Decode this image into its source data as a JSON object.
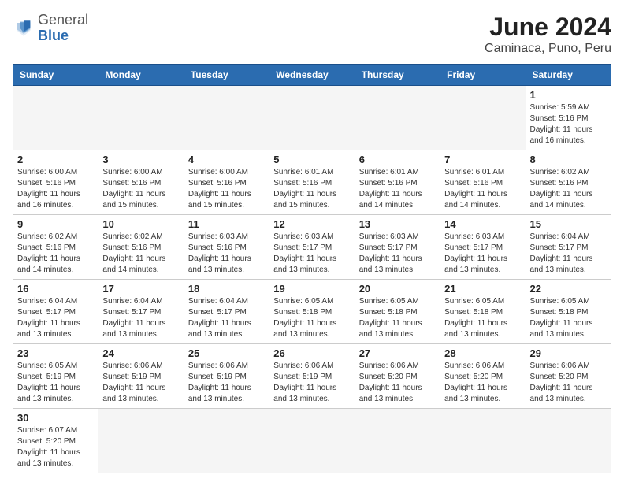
{
  "header": {
    "logo_general": "General",
    "logo_blue": "Blue",
    "month_year": "June 2024",
    "location": "Caminaca, Puno, Peru"
  },
  "days_of_week": [
    "Sunday",
    "Monday",
    "Tuesday",
    "Wednesday",
    "Thursday",
    "Friday",
    "Saturday"
  ],
  "weeks": [
    [
      {
        "day": null,
        "info": null
      },
      {
        "day": null,
        "info": null
      },
      {
        "day": null,
        "info": null
      },
      {
        "day": null,
        "info": null
      },
      {
        "day": null,
        "info": null
      },
      {
        "day": null,
        "info": null
      },
      {
        "day": "1",
        "info": "Sunrise: 5:59 AM\nSunset: 5:16 PM\nDaylight: 11 hours and 16 minutes."
      }
    ],
    [
      {
        "day": "2",
        "info": "Sunrise: 6:00 AM\nSunset: 5:16 PM\nDaylight: 11 hours and 16 minutes."
      },
      {
        "day": "3",
        "info": "Sunrise: 6:00 AM\nSunset: 5:16 PM\nDaylight: 11 hours and 15 minutes."
      },
      {
        "day": "4",
        "info": "Sunrise: 6:00 AM\nSunset: 5:16 PM\nDaylight: 11 hours and 15 minutes."
      },
      {
        "day": "5",
        "info": "Sunrise: 6:01 AM\nSunset: 5:16 PM\nDaylight: 11 hours and 15 minutes."
      },
      {
        "day": "6",
        "info": "Sunrise: 6:01 AM\nSunset: 5:16 PM\nDaylight: 11 hours and 14 minutes."
      },
      {
        "day": "7",
        "info": "Sunrise: 6:01 AM\nSunset: 5:16 PM\nDaylight: 11 hours and 14 minutes."
      },
      {
        "day": "8",
        "info": "Sunrise: 6:02 AM\nSunset: 5:16 PM\nDaylight: 11 hours and 14 minutes."
      }
    ],
    [
      {
        "day": "9",
        "info": "Sunrise: 6:02 AM\nSunset: 5:16 PM\nDaylight: 11 hours and 14 minutes."
      },
      {
        "day": "10",
        "info": "Sunrise: 6:02 AM\nSunset: 5:16 PM\nDaylight: 11 hours and 14 minutes."
      },
      {
        "day": "11",
        "info": "Sunrise: 6:03 AM\nSunset: 5:16 PM\nDaylight: 11 hours and 13 minutes."
      },
      {
        "day": "12",
        "info": "Sunrise: 6:03 AM\nSunset: 5:17 PM\nDaylight: 11 hours and 13 minutes."
      },
      {
        "day": "13",
        "info": "Sunrise: 6:03 AM\nSunset: 5:17 PM\nDaylight: 11 hours and 13 minutes."
      },
      {
        "day": "14",
        "info": "Sunrise: 6:03 AM\nSunset: 5:17 PM\nDaylight: 11 hours and 13 minutes."
      },
      {
        "day": "15",
        "info": "Sunrise: 6:04 AM\nSunset: 5:17 PM\nDaylight: 11 hours and 13 minutes."
      }
    ],
    [
      {
        "day": "16",
        "info": "Sunrise: 6:04 AM\nSunset: 5:17 PM\nDaylight: 11 hours and 13 minutes."
      },
      {
        "day": "17",
        "info": "Sunrise: 6:04 AM\nSunset: 5:17 PM\nDaylight: 11 hours and 13 minutes."
      },
      {
        "day": "18",
        "info": "Sunrise: 6:04 AM\nSunset: 5:17 PM\nDaylight: 11 hours and 13 minutes."
      },
      {
        "day": "19",
        "info": "Sunrise: 6:05 AM\nSunset: 5:18 PM\nDaylight: 11 hours and 13 minutes."
      },
      {
        "day": "20",
        "info": "Sunrise: 6:05 AM\nSunset: 5:18 PM\nDaylight: 11 hours and 13 minutes."
      },
      {
        "day": "21",
        "info": "Sunrise: 6:05 AM\nSunset: 5:18 PM\nDaylight: 11 hours and 13 minutes."
      },
      {
        "day": "22",
        "info": "Sunrise: 6:05 AM\nSunset: 5:18 PM\nDaylight: 11 hours and 13 minutes."
      }
    ],
    [
      {
        "day": "23",
        "info": "Sunrise: 6:05 AM\nSunset: 5:19 PM\nDaylight: 11 hours and 13 minutes."
      },
      {
        "day": "24",
        "info": "Sunrise: 6:06 AM\nSunset: 5:19 PM\nDaylight: 11 hours and 13 minutes."
      },
      {
        "day": "25",
        "info": "Sunrise: 6:06 AM\nSunset: 5:19 PM\nDaylight: 11 hours and 13 minutes."
      },
      {
        "day": "26",
        "info": "Sunrise: 6:06 AM\nSunset: 5:19 PM\nDaylight: 11 hours and 13 minutes."
      },
      {
        "day": "27",
        "info": "Sunrise: 6:06 AM\nSunset: 5:20 PM\nDaylight: 11 hours and 13 minutes."
      },
      {
        "day": "28",
        "info": "Sunrise: 6:06 AM\nSunset: 5:20 PM\nDaylight: 11 hours and 13 minutes."
      },
      {
        "day": "29",
        "info": "Sunrise: 6:06 AM\nSunset: 5:20 PM\nDaylight: 11 hours and 13 minutes."
      }
    ],
    [
      {
        "day": "30",
        "info": "Sunrise: 6:07 AM\nSunset: 5:20 PM\nDaylight: 11 hours and 13 minutes."
      },
      {
        "day": null,
        "info": null
      },
      {
        "day": null,
        "info": null
      },
      {
        "day": null,
        "info": null
      },
      {
        "day": null,
        "info": null
      },
      {
        "day": null,
        "info": null
      },
      {
        "day": null,
        "info": null
      }
    ]
  ]
}
